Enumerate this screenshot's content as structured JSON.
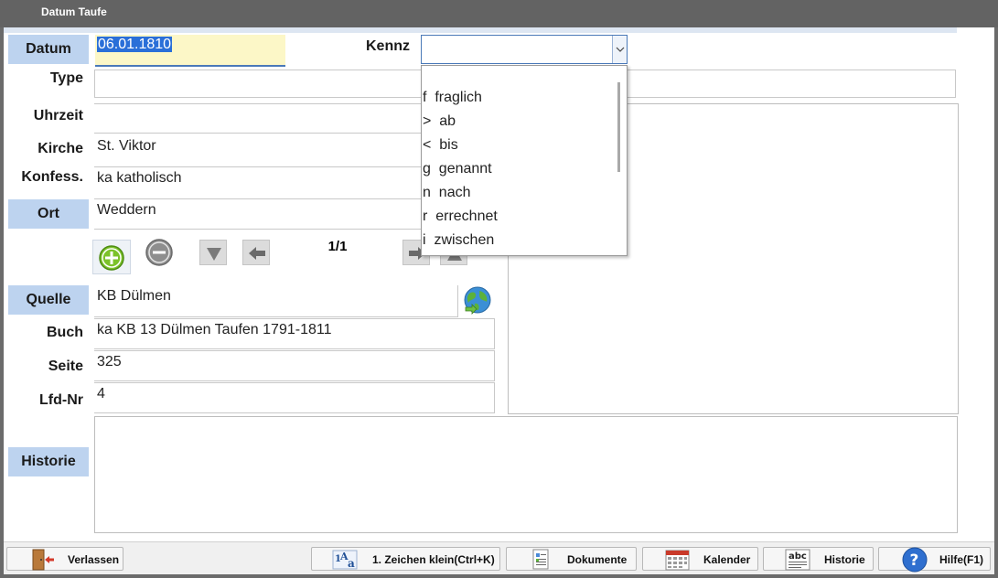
{
  "window": {
    "title": "Datum Taufe"
  },
  "labels": {
    "datum": "Datum",
    "type": "Type",
    "uhrzeit": "Uhrzeit",
    "kirche": "Kirche",
    "konfess": "Konfess.",
    "ort": "Ort",
    "quelle": "Quelle",
    "buch": "Buch",
    "seite": "Seite",
    "lfd_nr": "Lfd-Nr",
    "historie": "Historie",
    "kennz": "Kennz"
  },
  "fields": {
    "datum": "06.01.1810",
    "type": "",
    "uhrzeit": "",
    "kirche": "St. Viktor",
    "konfess": "ka   katholisch",
    "ort": "Weddern",
    "quelle": "KB Dülmen",
    "buch": "ka KB 13 Dülmen Taufen 1791-1811",
    "seite": "325",
    "lfd_nr": "4",
    "kennz": ""
  },
  "navigator": {
    "counter": "1/1"
  },
  "kennz_options": [
    "f  fraglich",
    ">  ab",
    "<  bis",
    "g  genannt",
    "n  nach",
    "r  errechnet",
    "i  zwischen"
  ],
  "footer": {
    "verlassen": "Verlassen",
    "zeichen_klein": "1. Zeichen klein(Ctrl+K)",
    "dokumente": "Dokumente",
    "kalender": "Kalender",
    "historie": "Historie",
    "hilfe": "Hilfe(F1)"
  },
  "icons": {
    "add": "plus-circle-icon",
    "remove": "minus-circle-icon",
    "down": "arrow-down-icon",
    "back": "arrow-left-icon",
    "forward": "arrow-right-icon",
    "up": "arrow-up-icon",
    "globe": "globe-icon",
    "exit": "door-exit-icon",
    "text": "text-case-icon",
    "docs": "documents-icon",
    "calendar": "calendar-icon",
    "history": "abc-history-icon",
    "help": "help-icon"
  },
  "colors": {
    "label_bg": "#bdd3ef",
    "date_bg": "#fcf7c7",
    "selection": "#2a6fd8",
    "add_green": "#7cc22a"
  }
}
